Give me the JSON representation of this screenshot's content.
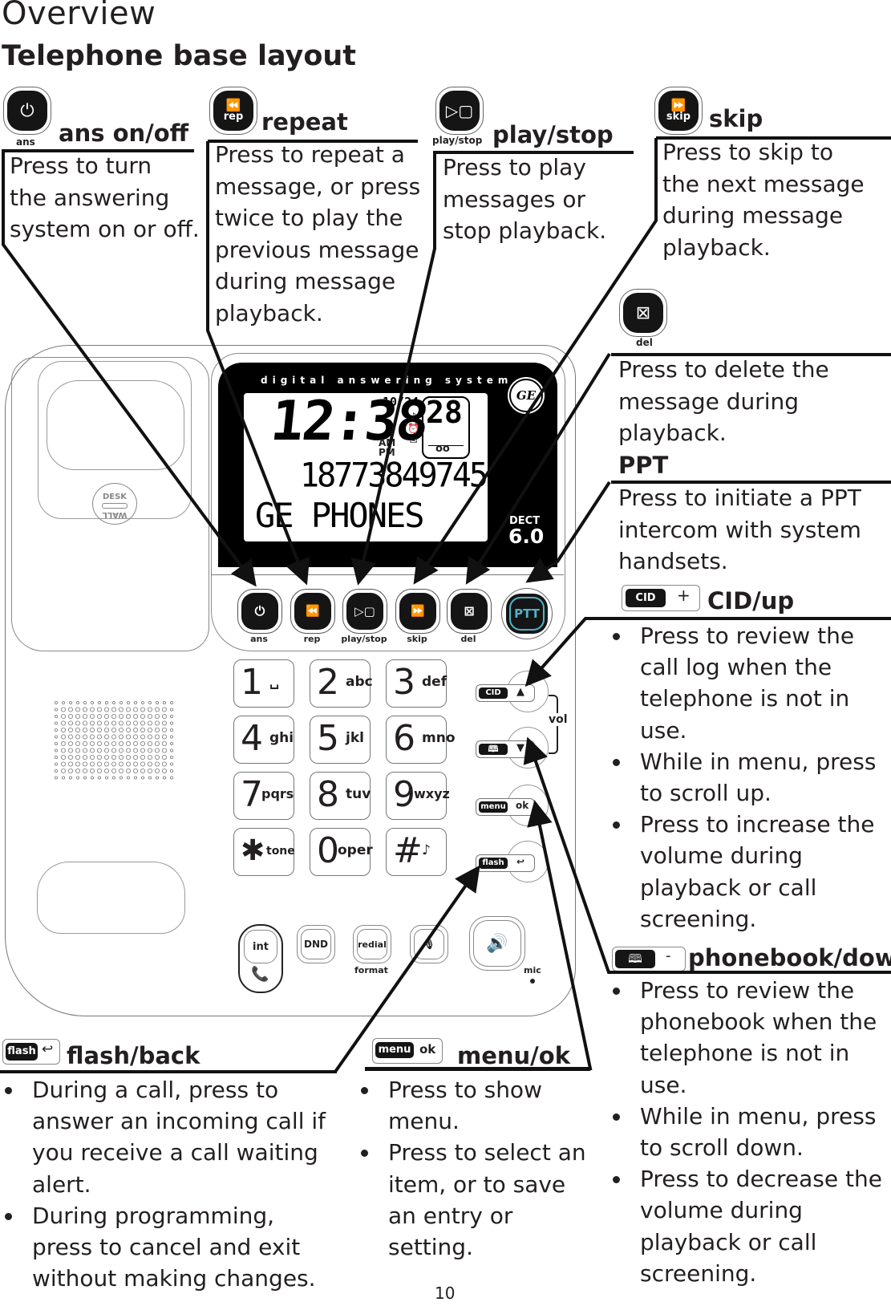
{
  "page": {
    "heading": "Overview",
    "subheading": "Telephone base layout",
    "page_number": "10"
  },
  "callouts": {
    "ans": {
      "icon_label": "ans",
      "title": "ans on/off",
      "lines": [
        "Press to turn",
        "the answering",
        "system on or off."
      ]
    },
    "repeat": {
      "icon_label": "rep",
      "title": "repeat",
      "lines": [
        "Press to repeat a",
        "message, or press",
        "twice to play the",
        "previous message",
        "during message",
        "playback."
      ]
    },
    "play_stop": {
      "icon_label": "play/stop",
      "title": "play/stop",
      "lines": [
        "Press to play",
        "messages or",
        "stop playback."
      ]
    },
    "skip": {
      "icon_label": "skip",
      "title": "skip",
      "lines": [
        "Press to skip to",
        "the next message",
        "during message",
        "playback."
      ]
    },
    "del": {
      "icon_label": "del",
      "lines": [
        "Press to delete the",
        "message during",
        "playback."
      ]
    },
    "ppt": {
      "title": "PPT",
      "lines": [
        "Press to initiate a PPT",
        "intercom with system",
        "handsets."
      ]
    },
    "cid_up": {
      "icon_dark": "CID",
      "icon_light": "+",
      "title": "CID/up",
      "bullets": [
        "Press to review the call log when the telephone is not in use.",
        "While in menu, press to scroll up.",
        "Press to increase the volume during playback or call screening."
      ]
    },
    "phonebook_down": {
      "icon_light": "-",
      "title": "phonebook/down",
      "bullets": [
        "Press to review the phonebook when the telephone is not in use.",
        "While in menu, press to scroll down.",
        "Press to decrease the volume during playback or call screening."
      ]
    },
    "flash_back": {
      "icon_dark": "flash",
      "icon_light": "⮌",
      "title": "flash/back",
      "bullets": [
        "During a call, press to answer an incoming call if you receive a call waiting alert.",
        "During programming, press to cancel and exit without making changes."
      ]
    },
    "menu_ok": {
      "icon_dark": "menu",
      "icon_light": "ok",
      "title": "menu/ok",
      "bullets": [
        "Press to show menu.",
        "Press to select an item, or to save an entry or setting."
      ]
    }
  },
  "device": {
    "panel_caption": "digital answering system",
    "brand": "GE",
    "dect_label": "DECT",
    "dect_version": "6.0",
    "lcd": {
      "time": "12:38",
      "date": "10/24",
      "am": "AM",
      "pm": "PM",
      "message_count": "28",
      "number": "18773849745",
      "name": "GE PHONES"
    },
    "desk_wall": [
      "DESK",
      "WALL"
    ],
    "top_buttons": [
      {
        "label": "ans"
      },
      {
        "label": "rep"
      },
      {
        "label": "play/stop"
      },
      {
        "label": "skip"
      },
      {
        "label": "del"
      }
    ],
    "ptt_label": "PTT",
    "keypad": [
      {
        "digit": "1",
        "letters": "␣"
      },
      {
        "digit": "2",
        "letters": "abc"
      },
      {
        "digit": "3",
        "letters": "def"
      },
      {
        "digit": "4",
        "letters": "ghi"
      },
      {
        "digit": "5",
        "letters": "jkl"
      },
      {
        "digit": "6",
        "letters": "mno"
      },
      {
        "digit": "7",
        "letters": "pqrs"
      },
      {
        "digit": "8",
        "letters": "tuv"
      },
      {
        "digit": "9",
        "letters": "wxyz"
      },
      {
        "digit": "✱",
        "letters": "tone"
      },
      {
        "digit": "0",
        "letters": "oper"
      },
      {
        "digit": "#",
        "letters": "♪"
      }
    ],
    "side_keys": {
      "cid": "CID",
      "menu": "menu",
      "ok": "ok",
      "flash": "flash",
      "vol": "vol"
    },
    "bottom_buttons": {
      "int": "int",
      "dnd": "DND",
      "redial": "redial",
      "format": "format",
      "mic": "mic"
    }
  },
  "colors": {
    "ptt_accent": "#4fb3c8",
    "ink": "#231f20"
  }
}
